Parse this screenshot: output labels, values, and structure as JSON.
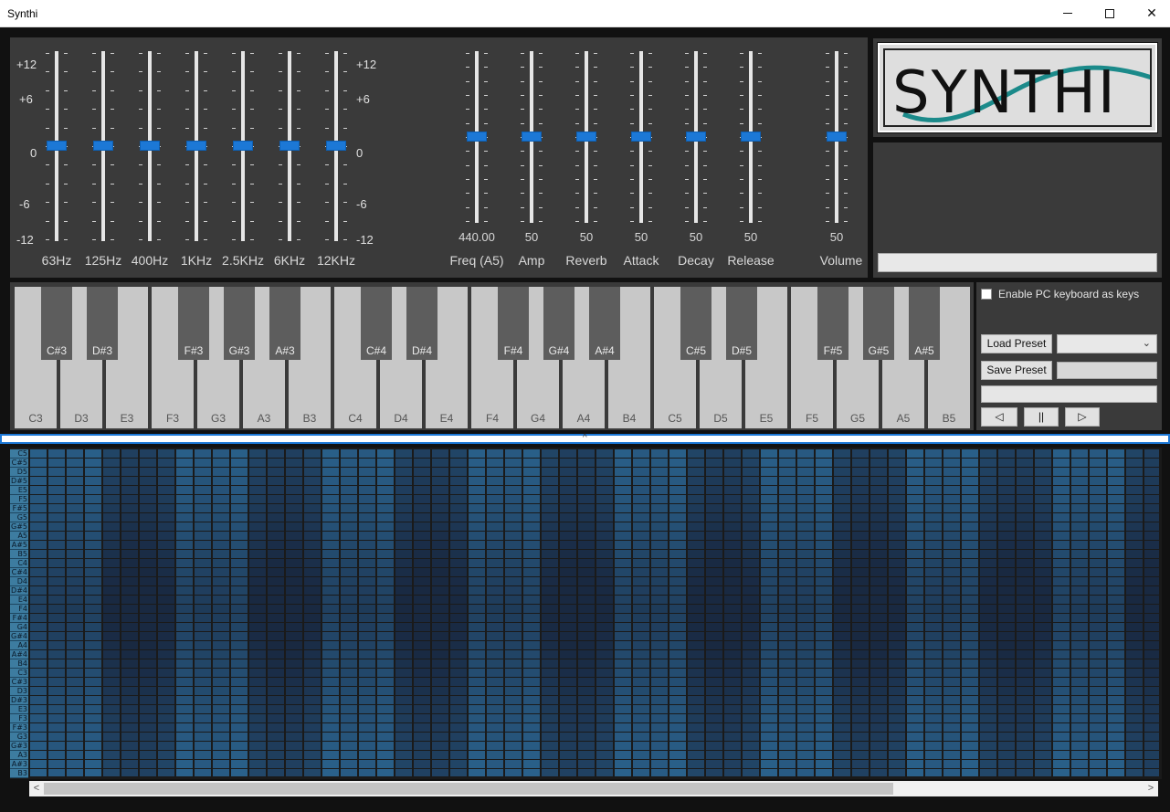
{
  "window": {
    "title": "Synthi"
  },
  "equalizer": {
    "scale_left": [
      "+12",
      "+6",
      "0",
      "-6",
      "-12"
    ],
    "scale_right": [
      "+12",
      "+6",
      "0",
      "-6",
      "-12"
    ],
    "bands": [
      {
        "label": "63Hz",
        "value": 0
      },
      {
        "label": "125Hz",
        "value": 0
      },
      {
        "label": "400Hz",
        "value": 0
      },
      {
        "label": "1KHz",
        "value": 0
      },
      {
        "label": "2.5KHz",
        "value": 0
      },
      {
        "label": "6KHz",
        "value": 0
      },
      {
        "label": "12KHz",
        "value": 0
      }
    ]
  },
  "synth_controls": [
    {
      "label": "Freq (A5)",
      "value_text": "440.00",
      "level": 0.5
    },
    {
      "label": "Amp",
      "value_text": "50",
      "level": 0.5
    },
    {
      "label": "Reverb",
      "value_text": "50",
      "level": 0.5
    },
    {
      "label": "Attack",
      "value_text": "50",
      "level": 0.5
    },
    {
      "label": "Decay",
      "value_text": "50",
      "level": 0.5
    },
    {
      "label": "Release",
      "value_text": "50",
      "level": 0.5
    },
    {
      "label": "Volume",
      "value_text": "50",
      "level": 0.5
    }
  ],
  "logo": {
    "text": "SYNTHI",
    "wave_color": "#1b8a8a"
  },
  "piano": {
    "white_keys": [
      "C3",
      "D3",
      "E3",
      "F3",
      "G3",
      "A3",
      "B3",
      "C4",
      "D4",
      "E4",
      "F4",
      "G4",
      "A4",
      "B4",
      "C5",
      "D5",
      "E5",
      "F5",
      "G5",
      "A5",
      "B5"
    ],
    "black_keys": [
      "C#3",
      "D#3",
      "F#3",
      "G#3",
      "A#3",
      "C#4",
      "D#4",
      "F#4",
      "G#4",
      "A#4",
      "C#5",
      "D#5",
      "F#5",
      "G#5",
      "A#5"
    ]
  },
  "controls": {
    "enable_pc_keyboard_label": "Enable PC keyboard as keys",
    "enable_pc_keyboard_checked": false,
    "load_preset_label": "Load Preset",
    "save_preset_label": "Save Preset",
    "prev_label": "◁",
    "pause_label": "||",
    "play_label": "▷"
  },
  "splitter": {
    "glyph": "^"
  },
  "sequencer": {
    "rows": [
      "C5",
      "C#5",
      "D5",
      "D#5",
      "E5",
      "F5",
      "F#5",
      "G5",
      "G#5",
      "A5",
      "A#5",
      "B5",
      "C4",
      "C#4",
      "D4",
      "D#4",
      "E4",
      "F4",
      "F#4",
      "G4",
      "G#4",
      "A4",
      "A#4",
      "B4",
      "C3",
      "C#3",
      "D3",
      "D#3",
      "E3",
      "F3",
      "F#3",
      "G3",
      "G#3",
      "A3",
      "A#3",
      "B3"
    ],
    "accent": "#1c78d6"
  },
  "colors": {
    "slider_thumb": "#1c78d6",
    "panel": "#3a3a3a"
  }
}
